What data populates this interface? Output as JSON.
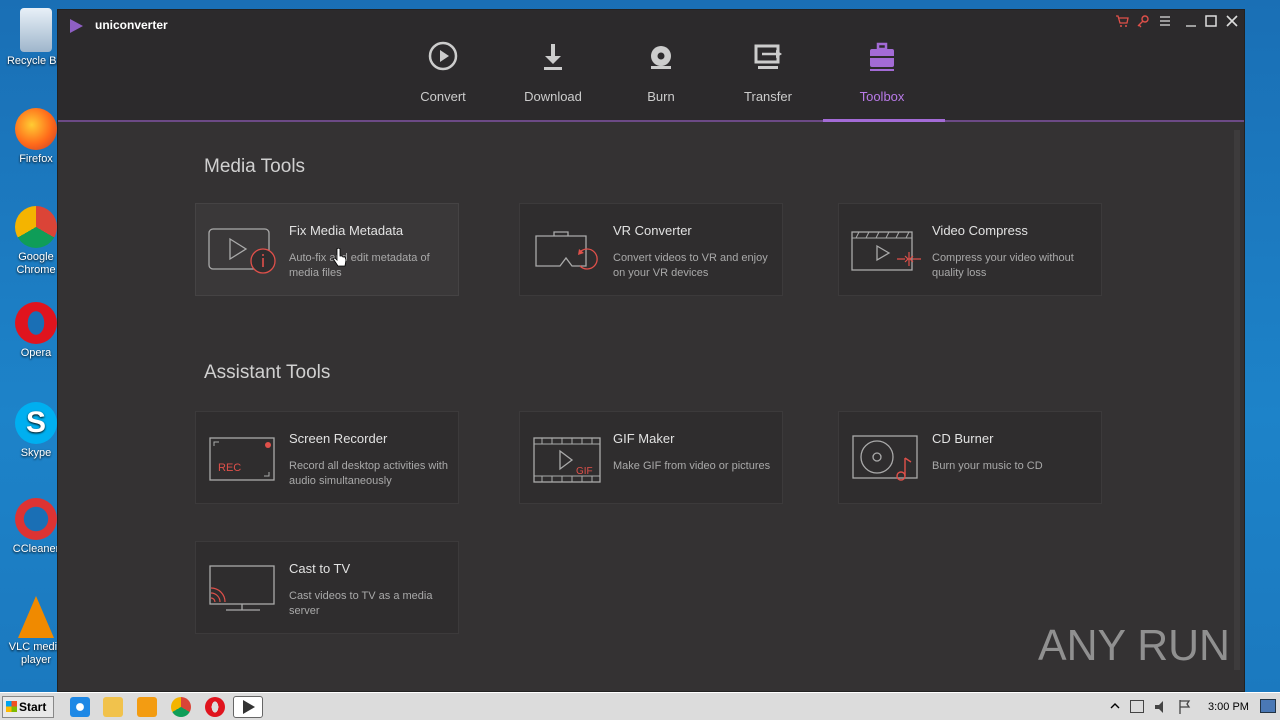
{
  "desktop": {
    "icons": [
      {
        "label": "Recycle Bin"
      },
      {
        "label": "Firefox"
      },
      {
        "label": "Google Chrome"
      },
      {
        "label": "Opera"
      },
      {
        "label": "Skype"
      },
      {
        "label": "CCleaner"
      },
      {
        "label": "VLC media player"
      }
    ]
  },
  "app": {
    "title": "uniconverter",
    "nav": [
      {
        "label": "Convert"
      },
      {
        "label": "Download"
      },
      {
        "label": "Burn"
      },
      {
        "label": "Transfer"
      },
      {
        "label": "Toolbox"
      }
    ],
    "sections": {
      "media": "Media Tools",
      "assistant": "Assistant Tools"
    },
    "media_tools": [
      {
        "title": "Fix Media Metadata",
        "desc": "Auto-fix and edit metadata of media files"
      },
      {
        "title": "VR Converter",
        "desc": "Convert videos to VR and enjoy on your VR devices"
      },
      {
        "title": "Video Compress",
        "desc": "Compress your video without quality loss"
      }
    ],
    "assistant_tools": [
      {
        "title": "Screen Recorder",
        "desc": "Record all desktop activities with audio simultaneously"
      },
      {
        "title": "GIF Maker",
        "desc": "Make GIF from video or pictures"
      },
      {
        "title": "CD Burner",
        "desc": "Burn your music to CD"
      },
      {
        "title": "Cast to TV",
        "desc": "Cast videos to TV as a media server"
      }
    ],
    "icon_text": {
      "rec": "REC",
      "gif": "GIF"
    }
  },
  "watermark": "ANY RUN",
  "taskbar": {
    "start": "Start",
    "clock": "3:00 PM"
  },
  "colors": {
    "accent": "#a36bd6",
    "icon_red": "#e0504a"
  }
}
